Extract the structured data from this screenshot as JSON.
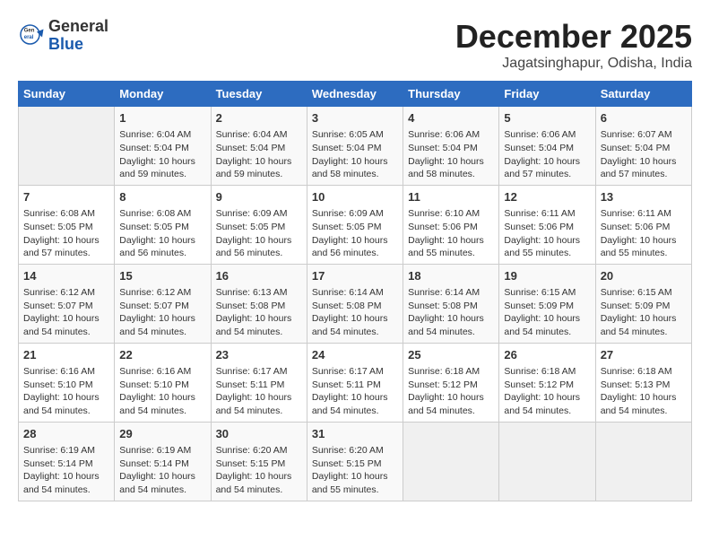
{
  "header": {
    "logo_general": "General",
    "logo_blue": "Blue",
    "month_title": "December 2025",
    "location": "Jagatsinghapur, Odisha, India"
  },
  "weekdays": [
    "Sunday",
    "Monday",
    "Tuesday",
    "Wednesday",
    "Thursday",
    "Friday",
    "Saturday"
  ],
  "weeks": [
    [
      {
        "day": "",
        "empty": true
      },
      {
        "day": "1",
        "sunrise": "6:04 AM",
        "sunset": "5:04 PM",
        "daylight": "10 hours and 59 minutes."
      },
      {
        "day": "2",
        "sunrise": "6:04 AM",
        "sunset": "5:04 PM",
        "daylight": "10 hours and 59 minutes."
      },
      {
        "day": "3",
        "sunrise": "6:05 AM",
        "sunset": "5:04 PM",
        "daylight": "10 hours and 58 minutes."
      },
      {
        "day": "4",
        "sunrise": "6:06 AM",
        "sunset": "5:04 PM",
        "daylight": "10 hours and 58 minutes."
      },
      {
        "day": "5",
        "sunrise": "6:06 AM",
        "sunset": "5:04 PM",
        "daylight": "10 hours and 57 minutes."
      },
      {
        "day": "6",
        "sunrise": "6:07 AM",
        "sunset": "5:04 PM",
        "daylight": "10 hours and 57 minutes."
      }
    ],
    [
      {
        "day": "7",
        "sunrise": "6:08 AM",
        "sunset": "5:05 PM",
        "daylight": "10 hours and 57 minutes."
      },
      {
        "day": "8",
        "sunrise": "6:08 AM",
        "sunset": "5:05 PM",
        "daylight": "10 hours and 56 minutes."
      },
      {
        "day": "9",
        "sunrise": "6:09 AM",
        "sunset": "5:05 PM",
        "daylight": "10 hours and 56 minutes."
      },
      {
        "day": "10",
        "sunrise": "6:09 AM",
        "sunset": "5:05 PM",
        "daylight": "10 hours and 56 minutes."
      },
      {
        "day": "11",
        "sunrise": "6:10 AM",
        "sunset": "5:06 PM",
        "daylight": "10 hours and 55 minutes."
      },
      {
        "day": "12",
        "sunrise": "6:11 AM",
        "sunset": "5:06 PM",
        "daylight": "10 hours and 55 minutes."
      },
      {
        "day": "13",
        "sunrise": "6:11 AM",
        "sunset": "5:06 PM",
        "daylight": "10 hours and 55 minutes."
      }
    ],
    [
      {
        "day": "14",
        "sunrise": "6:12 AM",
        "sunset": "5:07 PM",
        "daylight": "10 hours and 54 minutes."
      },
      {
        "day": "15",
        "sunrise": "6:12 AM",
        "sunset": "5:07 PM",
        "daylight": "10 hours and 54 minutes."
      },
      {
        "day": "16",
        "sunrise": "6:13 AM",
        "sunset": "5:08 PM",
        "daylight": "10 hours and 54 minutes."
      },
      {
        "day": "17",
        "sunrise": "6:14 AM",
        "sunset": "5:08 PM",
        "daylight": "10 hours and 54 minutes."
      },
      {
        "day": "18",
        "sunrise": "6:14 AM",
        "sunset": "5:08 PM",
        "daylight": "10 hours and 54 minutes."
      },
      {
        "day": "19",
        "sunrise": "6:15 AM",
        "sunset": "5:09 PM",
        "daylight": "10 hours and 54 minutes."
      },
      {
        "day": "20",
        "sunrise": "6:15 AM",
        "sunset": "5:09 PM",
        "daylight": "10 hours and 54 minutes."
      }
    ],
    [
      {
        "day": "21",
        "sunrise": "6:16 AM",
        "sunset": "5:10 PM",
        "daylight": "10 hours and 54 minutes."
      },
      {
        "day": "22",
        "sunrise": "6:16 AM",
        "sunset": "5:10 PM",
        "daylight": "10 hours and 54 minutes."
      },
      {
        "day": "23",
        "sunrise": "6:17 AM",
        "sunset": "5:11 PM",
        "daylight": "10 hours and 54 minutes."
      },
      {
        "day": "24",
        "sunrise": "6:17 AM",
        "sunset": "5:11 PM",
        "daylight": "10 hours and 54 minutes."
      },
      {
        "day": "25",
        "sunrise": "6:18 AM",
        "sunset": "5:12 PM",
        "daylight": "10 hours and 54 minutes."
      },
      {
        "day": "26",
        "sunrise": "6:18 AM",
        "sunset": "5:12 PM",
        "daylight": "10 hours and 54 minutes."
      },
      {
        "day": "27",
        "sunrise": "6:18 AM",
        "sunset": "5:13 PM",
        "daylight": "10 hours and 54 minutes."
      }
    ],
    [
      {
        "day": "28",
        "sunrise": "6:19 AM",
        "sunset": "5:14 PM",
        "daylight": "10 hours and 54 minutes."
      },
      {
        "day": "29",
        "sunrise": "6:19 AM",
        "sunset": "5:14 PM",
        "daylight": "10 hours and 54 minutes."
      },
      {
        "day": "30",
        "sunrise": "6:20 AM",
        "sunset": "5:15 PM",
        "daylight": "10 hours and 54 minutes."
      },
      {
        "day": "31",
        "sunrise": "6:20 AM",
        "sunset": "5:15 PM",
        "daylight": "10 hours and 55 minutes."
      },
      {
        "day": "",
        "empty": true
      },
      {
        "day": "",
        "empty": true
      },
      {
        "day": "",
        "empty": true
      }
    ]
  ],
  "labels": {
    "sunrise": "Sunrise:",
    "sunset": "Sunset:",
    "daylight": "Daylight:"
  }
}
